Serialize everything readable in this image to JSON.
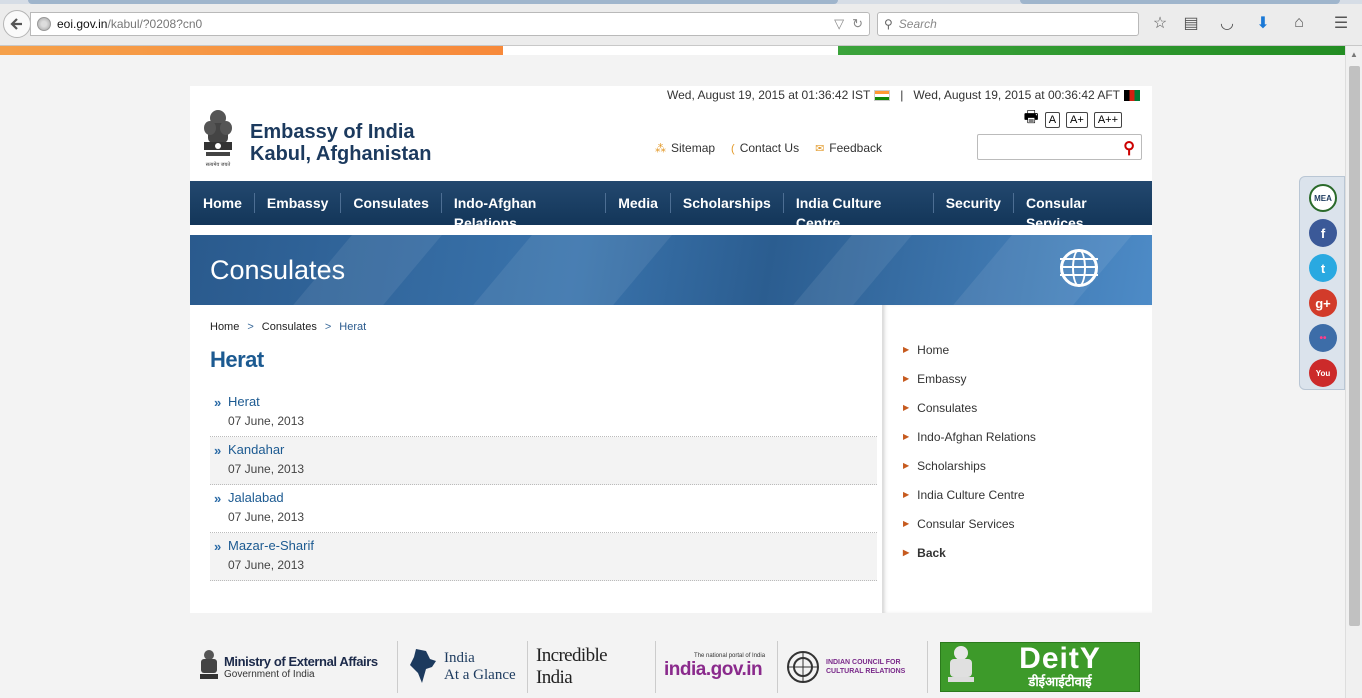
{
  "browser": {
    "url_host": "eoi.gov.in",
    "url_path": "/kabul/?0208?cn0",
    "search_placeholder": "Search"
  },
  "header": {
    "title_line1": "Embassy of India",
    "title_line2": "Kabul, Afghanistan",
    "emblem_caption": "सत्यमेव जयते",
    "time_india": "Wed, August 19, 2015 at 01:36:42 IST",
    "separator": "|",
    "time_afghanistan": "Wed, August 19, 2015 at 00:36:42 AFT",
    "font_small": "A",
    "font_large": "A+",
    "font_xlarge": "A++",
    "links": {
      "sitemap": "Sitemap",
      "contact": "Contact Us",
      "feedback": "Feedback"
    }
  },
  "nav": [
    "Home",
    "Embassy",
    "Consulates",
    "Indo-Afghan Relations",
    "Media",
    "Scholarships",
    "India Culture Centre",
    "Security",
    "Consular Services"
  ],
  "banner": {
    "title": "Consulates"
  },
  "breadcrumb": {
    "home": "Home",
    "section": "Consulates",
    "current": "Herat",
    "sep": ">"
  },
  "main": {
    "heading": "Herat",
    "items": [
      {
        "title": "Herat",
        "date": "07 June, 2013"
      },
      {
        "title": " Kandahar",
        "date": "07 June, 2013"
      },
      {
        "title": "Jalalabad",
        "date": "07 June, 2013"
      },
      {
        "title": "Mazar-e-Sharif",
        "date": "07 June, 2013"
      }
    ]
  },
  "sidebar": [
    "Home",
    "Embassy",
    "Consulates",
    "Indo-Afghan Relations",
    "Scholarships",
    "India Culture Centre",
    "Consular Services",
    "Back"
  ],
  "footer": {
    "mea_line1": "Ministry of External Affairs",
    "mea_line2": "Government of India",
    "glance_line1": "India",
    "glance_line2": "At a Glance",
    "incredible": "Incredible India",
    "portal_top": "The national portal of India",
    "portal": "india.gov.in",
    "iccr_line1": "INDIAN COUNCIL FOR",
    "iccr_line2": "CULTURAL RELATIONS",
    "deity_line1": "DeitY",
    "deity_line2": "डीईआईटीवाई"
  },
  "social": {
    "mea": "MEA",
    "facebook": "f",
    "twitter": "t",
    "gplus": "g+",
    "flickr": "••",
    "youtube": "You"
  },
  "colors": {
    "nav_bg": "#1a3f66",
    "accent_blue": "#1c5a91",
    "saffron": "#ff9933",
    "green": "#138808"
  }
}
